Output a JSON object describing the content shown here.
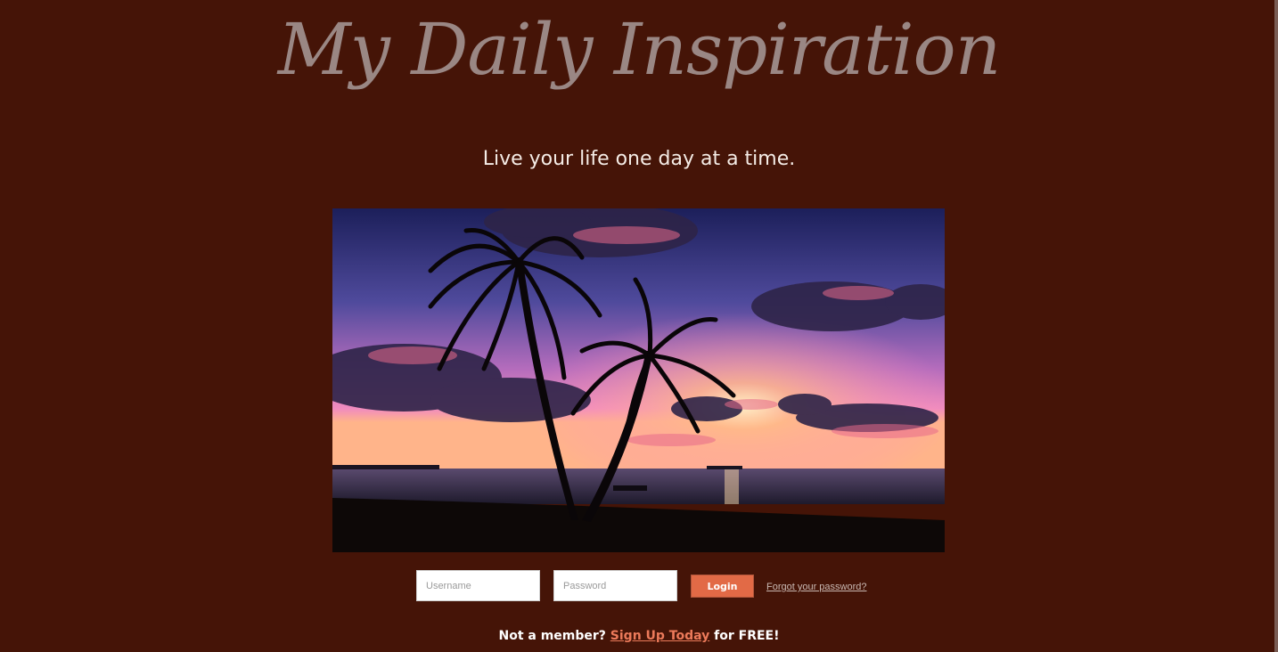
{
  "header": {
    "site_title": "My Daily Inspiration",
    "tagline": "Live your life one day at a time."
  },
  "hero": {
    "image_name": "sunset-palm-beach-photo"
  },
  "login_form": {
    "username_placeholder": "Username",
    "password_placeholder": "Password",
    "login_label": "Login",
    "forgot_password_label": "Forgot your password?"
  },
  "signup": {
    "prefix": "Not a member?",
    "link_label": "Sign Up Today",
    "suffix": "for FREE!"
  },
  "colors": {
    "background": "#451407",
    "title": "#9a8784",
    "accent": "#e26a46",
    "signup_link": "#ec7a5a"
  }
}
